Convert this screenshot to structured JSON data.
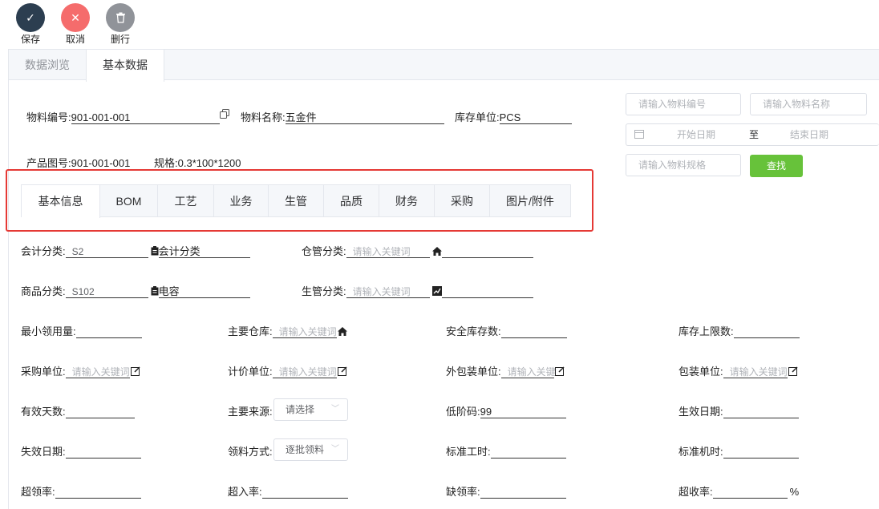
{
  "toolbar": {
    "save": {
      "label": "保存",
      "color": "#2c3e50"
    },
    "cancel": {
      "label": "取消",
      "color": "#f56c6c"
    },
    "delete": {
      "label": "删行",
      "color": "#909399"
    }
  },
  "tabs": [
    "数据浏览",
    "基本数据"
  ],
  "header": {
    "material_code": {
      "label": "物料编号:",
      "value": "901-001-001"
    },
    "material_name": {
      "label": "物料名称:",
      "value": "五金件"
    },
    "stock_unit": {
      "label": "库存单位:",
      "value": "PCS"
    },
    "drawing_no": {
      "label": "产品图号:",
      "value": "901-001-001"
    },
    "spec": {
      "label": "规格:",
      "value": "0.3*100*1200"
    }
  },
  "search": {
    "code_placeholder": "请输入物料编号",
    "name_placeholder": "请输入物料名称",
    "start_date": "开始日期",
    "to": "至",
    "end_date": "结束日期",
    "spec_placeholder": "请输入物料规格",
    "find": "查找"
  },
  "sub_tabs": [
    "基本信息",
    "BOM",
    "工艺",
    "业务",
    "生管",
    "品质",
    "财务",
    "采购",
    "图片/附件"
  ],
  "form": {
    "acct_class": {
      "label": "会计分类:",
      "code": "S2",
      "name": "会计分类"
    },
    "wh_class": {
      "label": "仓管分类:",
      "placeholder": "请输入关键词"
    },
    "goods_class": {
      "label": "商品分类:",
      "code": "S102",
      "name": "电容"
    },
    "prod_class": {
      "label": "生管分类:",
      "placeholder": "请输入关键词"
    },
    "min_qty": {
      "label": "最小领用量:"
    },
    "main_wh": {
      "label": "主要仓库:",
      "placeholder": "请输入关键词"
    },
    "safety_stock": {
      "label": "安全库存数:"
    },
    "stock_max": {
      "label": "库存上限数:"
    },
    "purchase_unit": {
      "label": "采购单位:",
      "placeholder": "请输入关键词"
    },
    "price_unit": {
      "label": "计价单位:",
      "placeholder": "请输入关键词"
    },
    "outer_pack": {
      "label": "外包装单位:",
      "placeholder": "请输入关键"
    },
    "pack_unit": {
      "label": "包装单位:",
      "placeholder": "请输入关键词"
    },
    "valid_days": {
      "label": "有效天数:"
    },
    "main_source": {
      "label": "主要来源:",
      "value": "请选择"
    },
    "low_code": {
      "label": "低阶码:",
      "value": "99"
    },
    "effective_date": {
      "label": "生效日期:"
    },
    "expire_date": {
      "label": "失效日期:"
    },
    "issue_method": {
      "label": "领料方式:",
      "value": "逐批领料"
    },
    "std_labor": {
      "label": "标准工时:"
    },
    "std_machine": {
      "label": "标准机时:"
    },
    "over_issue": {
      "label": "超领率:"
    },
    "over_receive": {
      "label": "超入率:"
    },
    "short_issue": {
      "label": "缺领率:"
    },
    "over_accept": {
      "label": "超收率:",
      "suffix": "%"
    }
  }
}
